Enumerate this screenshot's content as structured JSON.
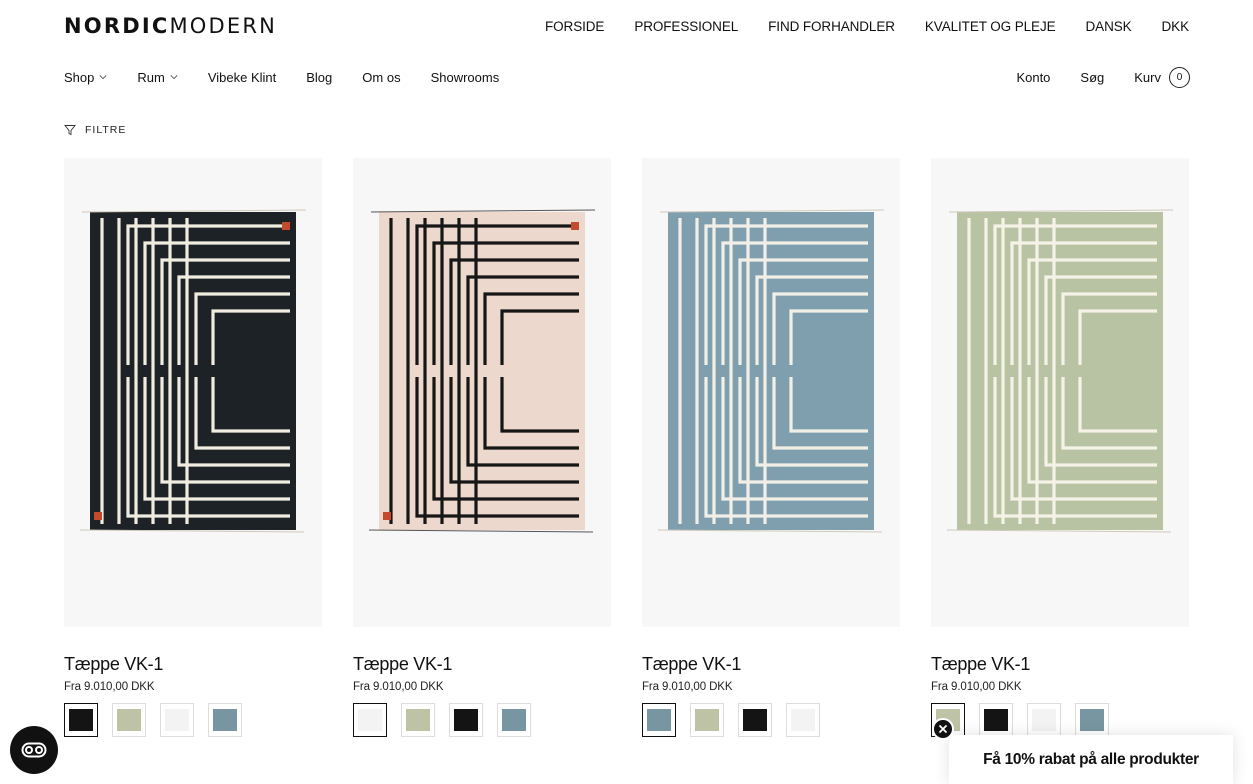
{
  "brand": {
    "bold": "NORDIC",
    "light": "MODERN"
  },
  "top_nav": [
    "FORSIDE",
    "PROFESSIONEL",
    "FIND FORHANDLER",
    "KVALITET OG PLEJE",
    "DANSK",
    "DKK"
  ],
  "main_nav": {
    "shop": "Shop",
    "rum": "Rum",
    "vibeke": "Vibeke Klint",
    "blog": "Blog",
    "om": "Om os",
    "showrooms": "Showrooms"
  },
  "account": {
    "konto": "Konto",
    "sog": "Søg",
    "kurv": "Kurv",
    "count": "0"
  },
  "filter_label": "FILTRE",
  "colors": {
    "black": "#141414",
    "sage": "#bec3a6",
    "white": "#f3f3f3",
    "blue": "#7896a1",
    "rug_black": "#1d2226",
    "rug_pink": "#ecd8cc",
    "rug_blue": "#7f9faf",
    "rug_sage": "#b8c3a4",
    "accent_red": "#c34a2c"
  },
  "products": [
    {
      "title": "Tæppe VK-1",
      "price": "Fra 9.010,00 DKK",
      "variant": "black",
      "swatches": [
        "black",
        "sage",
        "white",
        "blue"
      ],
      "selected": 0
    },
    {
      "title": "Tæppe VK-1",
      "price": "Fra 9.010,00 DKK",
      "variant": "pink",
      "swatches": [
        "white",
        "sage",
        "black",
        "blue"
      ],
      "selected": 0
    },
    {
      "title": "Tæppe VK-1",
      "price": "Fra 9.010,00 DKK",
      "variant": "blue",
      "swatches": [
        "blue",
        "sage",
        "black",
        "white"
      ],
      "selected": 0
    },
    {
      "title": "Tæppe VK-1",
      "price": "Fra 9.010,00 DKK",
      "variant": "sage",
      "swatches": [
        "sage",
        "black",
        "white",
        "blue"
      ],
      "selected": 0
    }
  ],
  "promo_text": "Få 10% rabat på alle produkter",
  "icons": {
    "accessibility": "accessibility-eye-icon",
    "close": "close-icon",
    "filter": "filter-funnel-icon",
    "chevron": "chevron-down-icon"
  }
}
